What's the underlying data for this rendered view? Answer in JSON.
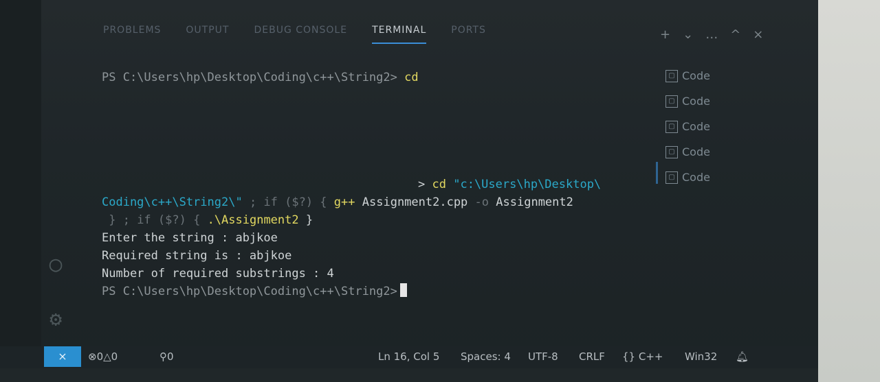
{
  "panel": {
    "tabs": [
      "PROBLEMS",
      "OUTPUT",
      "DEBUG CONSOLE",
      "TERMINAL",
      "PORTS"
    ],
    "active_tab": "TERMINAL",
    "actions": [
      "+",
      "⌄",
      "…",
      "^",
      "×"
    ]
  },
  "terminal": {
    "line1_prompt": "PS C:\\Users\\hp\\Desktop\\Coding\\c++\\String2>",
    "line1_cmd": "cd",
    "line2_prefix": ">",
    "line2_cmd": "cd",
    "line2_path": "\"c:\\Users\\hp\\Desktop\\",
    "line3_path": "Coding\\c++\\String2\\\"",
    "line3_sep": "; if ($?) {",
    "line3_cmd": "g++",
    "line3_file": "Assignment2.cpp",
    "line3_flag": "-o",
    "line3_out": "Assignment2",
    "line4_a": "} ; if ($?) {",
    "line4_run": ".\\Assignment2",
    "line4_b": "}",
    "output": [
      "Enter the string : abjkoe",
      "Required string is : abjkoe",
      "Number of required substrings : 4"
    ],
    "final_prompt": "PS C:\\Users\\hp\\Desktop\\Coding\\c++\\String2>"
  },
  "terminal_list": {
    "items": [
      "Code",
      "Code",
      "Code",
      "Code",
      "Code"
    ]
  },
  "status": {
    "remote_icon": "remote-icon",
    "errors": "0",
    "warnings": "0",
    "ports": "0",
    "position": "Ln 16, Col 5",
    "spaces": "Spaces: 4",
    "encoding": "UTF-8",
    "eol": "CRLF",
    "language": "C++",
    "platform": "Win32"
  },
  "colors": {
    "accent": "#2a8fd0",
    "yellow": "#e2d860",
    "cyan": "#2ba9c9",
    "green": "#5aa646"
  }
}
